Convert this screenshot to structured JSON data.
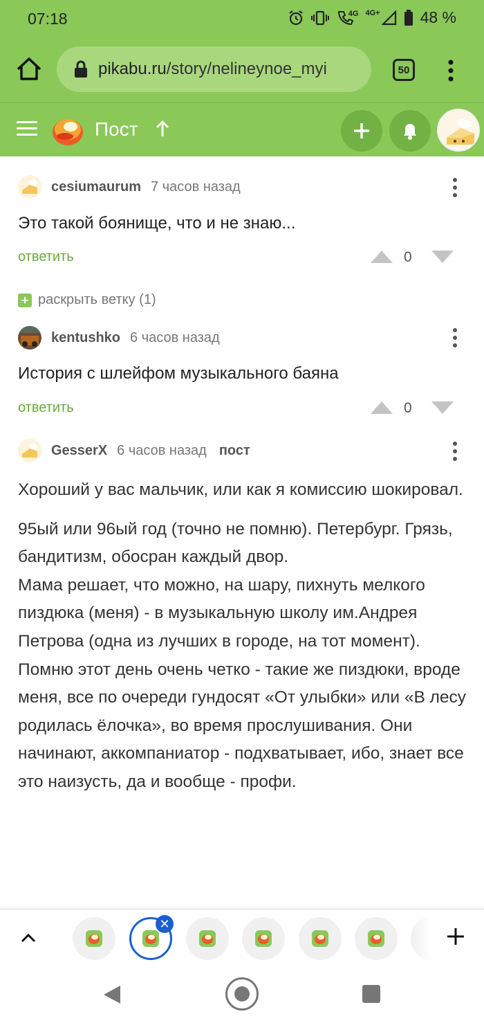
{
  "status_bar": {
    "time": "07:18",
    "network": "4G",
    "network2": "4G+",
    "battery": "48 %"
  },
  "browser": {
    "url_domain": "pikabu.ru",
    "url_path": "/story/nelineynoe_myi",
    "tabs_count": "50"
  },
  "header": {
    "title": "Пост"
  },
  "comments": [
    {
      "author": "cesiumaurum",
      "time": "7 часов назад",
      "text": "Это такой боянище, что и не знаю...",
      "reply": "ответить",
      "votes": "0"
    },
    {
      "author": "kentushko",
      "time": "6 часов назад",
      "text": "История с шлейфом музыкального баяна",
      "reply": "ответить",
      "votes": "0"
    },
    {
      "author": "GesserX",
      "time": "6 часов назад",
      "tag": "пост"
    }
  ],
  "expand_branch": "раскрыть ветку (1)",
  "post": {
    "paragraphs": [
      "Хороший у вас мальчик, или как я комиссию шокировал.",
      "95ый или 96ый год (точно не помню). Петербург. Грязь, бандитизм, обосран каждый двор.",
      "Мама решает, что можно, на шару, пихнуть мелкого пиздюка (меня) - в музыкальную школу им.Андрея Петрова (одна из лучших в городе, на тот момент).",
      "Помню этот день очень четко - такие же пиздюки, вроде меня, все по очереди гундосят «От улыбки» или «В лесу родилась ёлочка», во время прослушивания. Они начинают, аккомпаниатор - подхватывает, ибо, знает все это наизусть, да и вообще - профи."
    ]
  },
  "colors": {
    "brand_green": "#8ac858",
    "reply_green": "#6aa83c",
    "active_tab_blue": "#1a5fd0"
  },
  "icons": [
    "home-icon",
    "lock-icon",
    "menu-icon",
    "pikabu-logo",
    "arrow-up-icon",
    "plus-icon",
    "bell-icon",
    "avatar",
    "kebab-icon",
    "vote-up-icon",
    "vote-down-icon",
    "chevron-up-icon",
    "close-icon",
    "back-icon",
    "home-circle-icon",
    "recents-icon"
  ]
}
